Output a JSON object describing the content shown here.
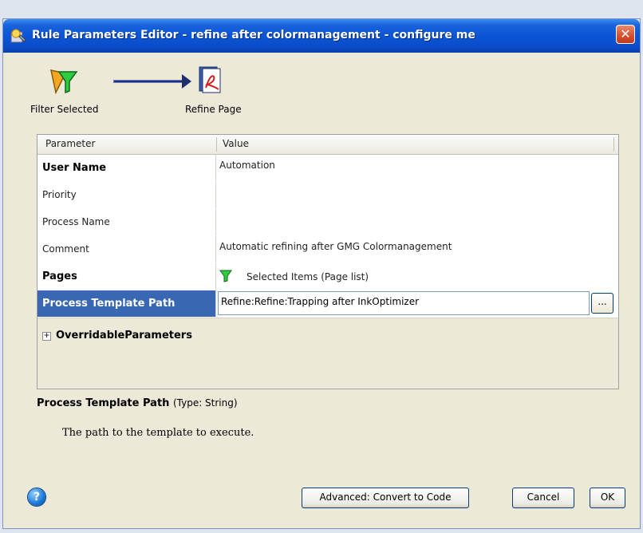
{
  "window": {
    "title": "Rule Parameters Editor - refine after colormanagement - configure me",
    "close_glyph": "✕"
  },
  "workflow": {
    "nodes": [
      {
        "label": "Filter Selected",
        "icon": "filter-icon"
      },
      {
        "label": "Refine Page",
        "icon": "refine-page-icon"
      }
    ]
  },
  "grid": {
    "headers": {
      "parameter": "Parameter",
      "value": "Value"
    },
    "rows": [
      {
        "name": "User Name",
        "value": "Automation"
      },
      {
        "name": "Priority",
        "value": ""
      },
      {
        "name": "Process Name",
        "value": ""
      },
      {
        "name": "Comment",
        "value": "Automatic refining after GMG Colormanagement"
      },
      {
        "name": "Pages",
        "value": "Selected Items (Page list)"
      },
      {
        "name": "Process Template Path",
        "value": "Refine:Refine:Trapping after InkOptimizer"
      }
    ],
    "ellipsis_label": "...",
    "group_expander": "+",
    "group_label": "OverridableParameters"
  },
  "description": {
    "title": "Process Template Path",
    "type": "(Type: String)",
    "text": "The path to the template to execute."
  },
  "footer": {
    "help_label": "?",
    "convert_label": "Advanced: Convert to Code",
    "cancel_label": "Cancel",
    "ok_label": "OK"
  },
  "colors": {
    "title_bar": "#0a55d6",
    "selected_row": "#3a67b4",
    "dialog_bg": "#ece9d8"
  }
}
